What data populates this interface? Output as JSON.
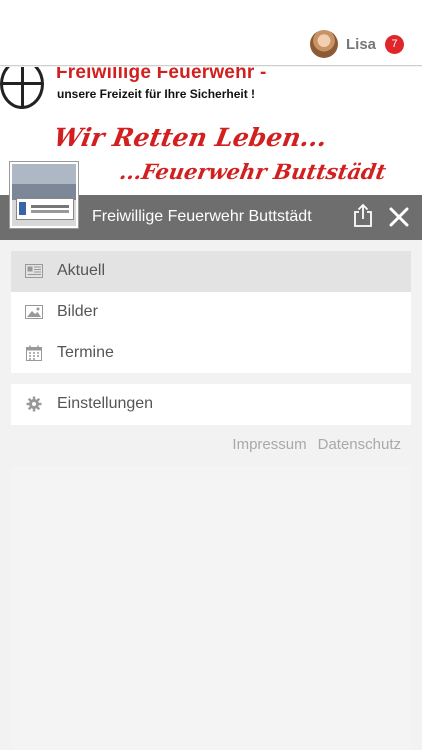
{
  "user": {
    "name": "Lisa",
    "badge_count": "7"
  },
  "banner": {
    "title": "Freiwillige Feuerwehr -",
    "subtitle": "unsere Freizeit für Ihre Sicherheit !",
    "slogan_line1": "Wir Retten Leben...",
    "slogan_line2": "...Feuerwehr Buttstädt"
  },
  "header": {
    "title": "Freiwillige Feuerwehr Buttstädt"
  },
  "menu": {
    "items": [
      {
        "label": "Aktuell",
        "icon": "newspaper-icon",
        "active": true
      },
      {
        "label": "Bilder",
        "icon": "image-icon",
        "active": false
      },
      {
        "label": "Termine",
        "icon": "calendar-icon",
        "active": false
      }
    ],
    "settings": {
      "label": "Einstellungen",
      "icon": "gear-icon"
    }
  },
  "footer": {
    "impressum": "Impressum",
    "datenschutz": "Datenschutz"
  },
  "colors": {
    "accent_red": "#d21f1f",
    "header_bar": "#6e6e6e",
    "badge": "#e0262b"
  }
}
